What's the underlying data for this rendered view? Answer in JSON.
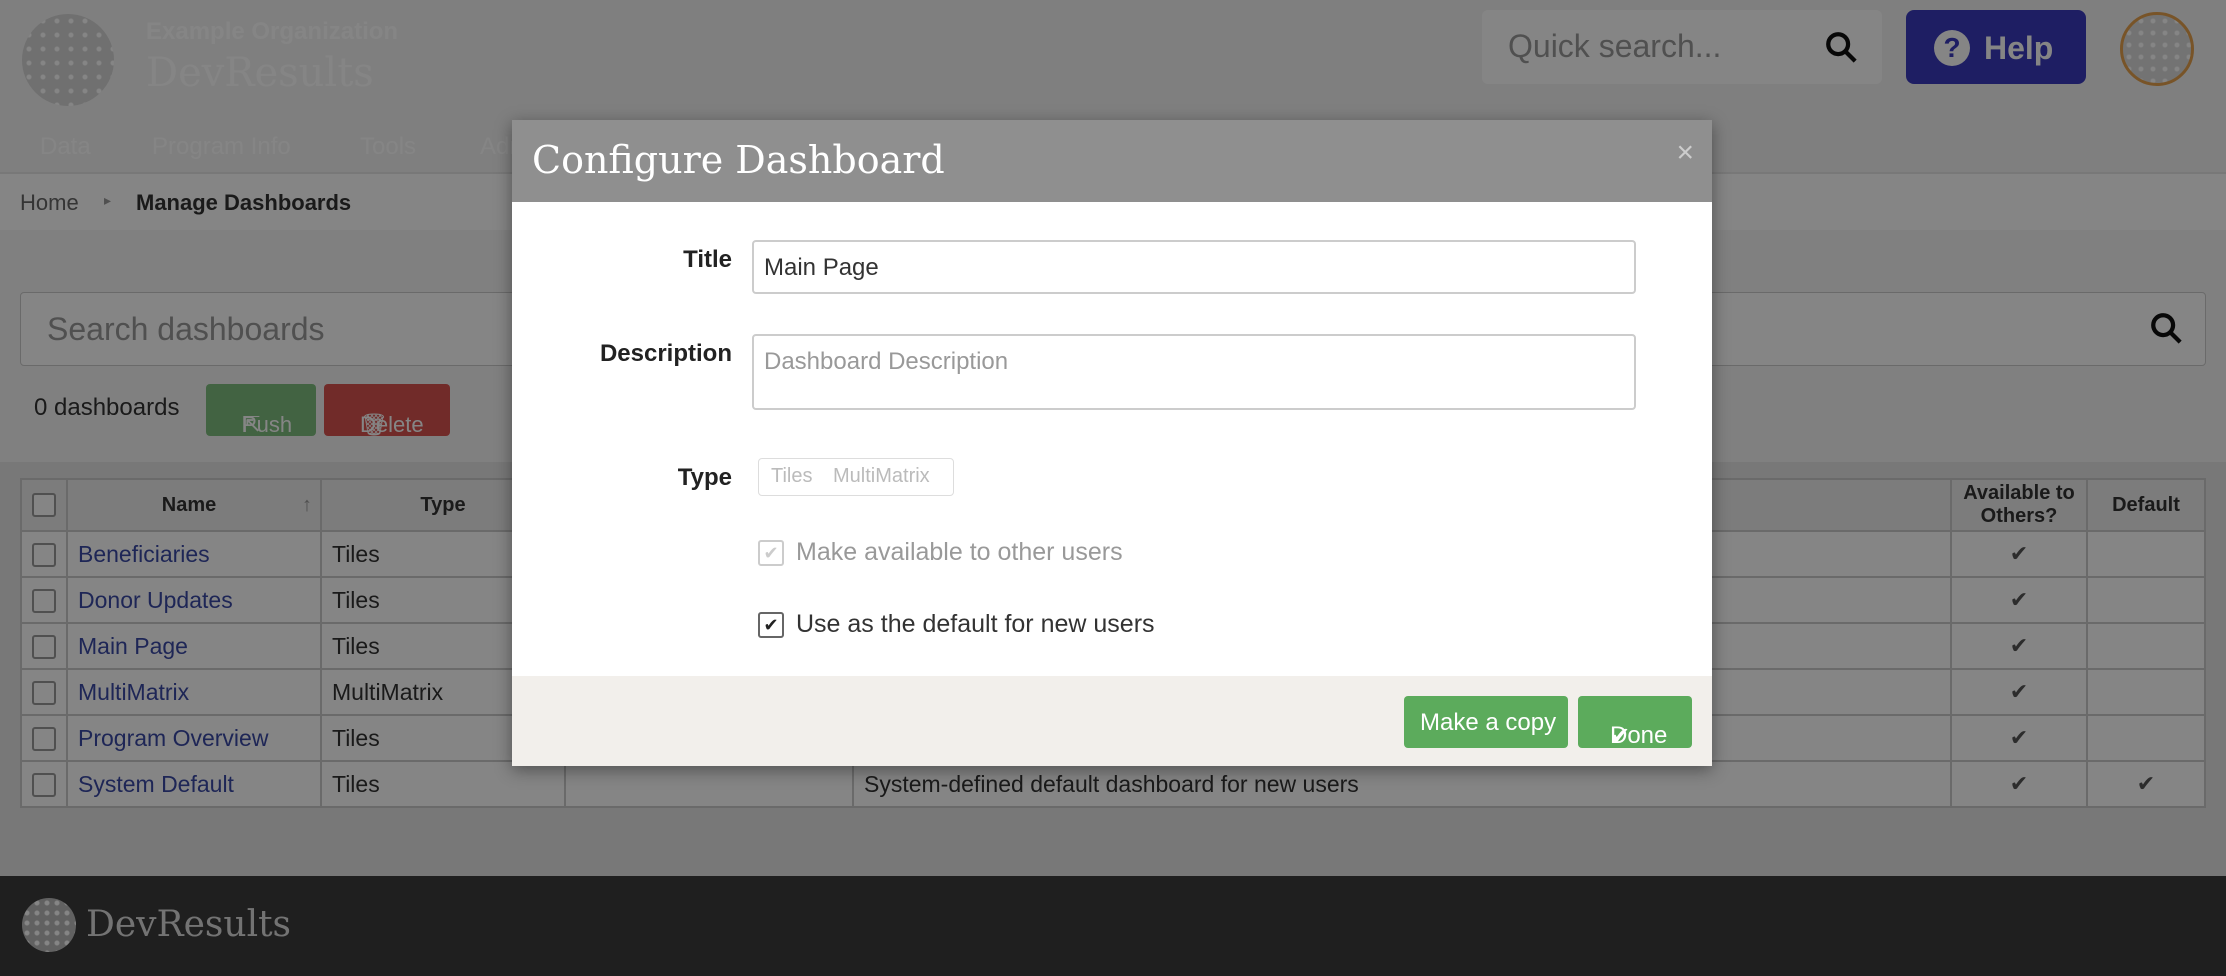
{
  "header": {
    "org_name": "Example Organization",
    "brand": "DevResults",
    "quick_search_placeholder": "Quick search...",
    "help_label": "Help",
    "nav": [
      "Data",
      "Program Info",
      "Tools",
      "Adm"
    ]
  },
  "breadcrumb": {
    "home": "Home",
    "current": "Manage Dashboards"
  },
  "toolbar": {
    "search_placeholder": "Search dashboards",
    "count": "0 dashboards",
    "push_label": "Push",
    "delete_label": "Delete"
  },
  "table": {
    "columns": [
      "Name",
      "Type",
      "",
      "",
      "Available to Others?",
      "Default"
    ],
    "rows": [
      {
        "name": "Beneficiaries",
        "type": "Tiles",
        "desc": "",
        "available": "✔",
        "default": ""
      },
      {
        "name": "Donor Updates",
        "type": "Tiles",
        "desc": "",
        "available": "✔",
        "default": ""
      },
      {
        "name": "Main Page",
        "type": "Tiles",
        "desc": "",
        "available": "✔",
        "default": ""
      },
      {
        "name": "MultiMatrix",
        "type": "MultiMatrix",
        "desc": "",
        "available": "✔",
        "default": ""
      },
      {
        "name": "Program Overview",
        "type": "Tiles",
        "desc": "",
        "available": "✔",
        "default": ""
      },
      {
        "name": "System Default",
        "type": "Tiles",
        "desc": "System-defined default dashboard for new users",
        "available": "✔",
        "default": "✔"
      }
    ]
  },
  "modal": {
    "title": "Configure Dashboard",
    "close": "×",
    "title_label": "Title",
    "title_value": "Main Page",
    "description_label": "Description",
    "description_placeholder": "Dashboard Description",
    "type_label": "Type",
    "type_options": [
      "Tiles",
      "MultiMatrix"
    ],
    "available_label": "Make available to other users",
    "default_label": "Use as the default for new users",
    "copy_label": "Make a copy",
    "done_label": "Done"
  },
  "footer": {
    "brand": "DevResults"
  }
}
